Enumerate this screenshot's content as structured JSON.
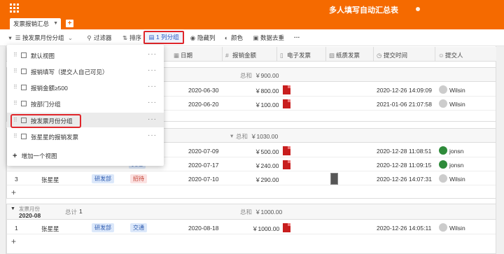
{
  "app": {
    "title": "多人填写自动汇总表"
  },
  "tabs": [
    {
      "label": "发票报销汇总"
    }
  ],
  "toolbar": {
    "group_by": "按发票月份分组",
    "filter": "过滤器",
    "sort": "排序",
    "grouped": "1 列分组",
    "hide_columns": "隐藏列",
    "color": "颜色",
    "dedupe": "数据去重",
    "more": "···"
  },
  "columns": [
    "日期",
    "报销金额",
    "电子发票",
    "纸质发票",
    "提交时间",
    "提交人"
  ],
  "views": {
    "items": [
      {
        "label": "默认视图"
      },
      {
        "label": "报销填写（提交人自己可见）"
      },
      {
        "label": "报销金额≥500"
      },
      {
        "label": "按部门分组"
      },
      {
        "label": "按发票月份分组"
      },
      {
        "label": "张星星的报销发票"
      }
    ],
    "add_label": "增加一个视图",
    "more": "···"
  },
  "groups": [
    {
      "sum_label": "总和",
      "sum_value": "￥900.00",
      "rows": [
        {
          "date": "2020-06-30",
          "amount": "￥800.00",
          "pdf": true,
          "submitted": "2020-12-26 14:09:09",
          "user": "Wilsin",
          "avatar": "gray"
        },
        {
          "date": "2020-06-20",
          "amount": "￥100.00",
          "pdf": true,
          "submitted": "2021-01-06 21:07:58",
          "user": "Wilsin",
          "avatar": "gray"
        }
      ]
    },
    {
      "sum_label": "总和",
      "sum_value": "￥1030.00",
      "rows": [
        {
          "date": "2020-07-09",
          "amount": "￥500.00",
          "pdf": true,
          "submitted": "2020-12-28 11:08:51",
          "user": "jonsn",
          "avatar": "green"
        },
        {
          "date": "2020-07-17",
          "amount": "￥240.00",
          "pdf": true,
          "submitted": "2020-12-28 11:09:15",
          "user": "jonsn",
          "avatar": "green"
        },
        {
          "num": "3",
          "name": "张星星",
          "dept": "研发部",
          "type": "招待",
          "date": "2020-07-10",
          "amount": "￥290.00",
          "thumb": true,
          "submitted": "2020-12-26 14:07:31",
          "user": "Wilsin",
          "avatar": "gray"
        }
      ],
      "partial": {
        "dept": "研发",
        "type": "交通"
      }
    },
    {
      "month_label": "发票月份",
      "month_value": "2020-08",
      "count_label": "总计",
      "count": "1",
      "sum_label": "总和",
      "sum_value": "￥1000.00",
      "rows": [
        {
          "num": "1",
          "name": "张星星",
          "dept": "研发部",
          "type": "交通",
          "date": "2020-08-18",
          "amount": "￥1000.00",
          "pdf": true,
          "submitted": "2020-12-26 14:05:11",
          "user": "Wilsin",
          "avatar": "gray"
        }
      ]
    }
  ],
  "colors": {
    "brand": "#f56a00",
    "highlight": "#e0262b"
  }
}
